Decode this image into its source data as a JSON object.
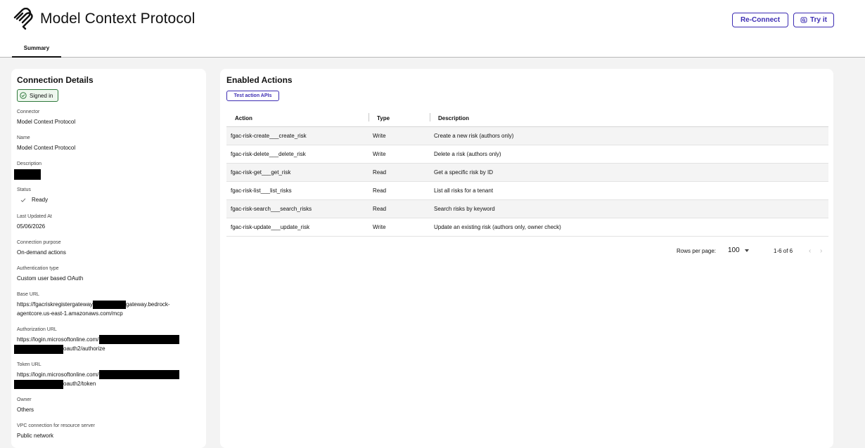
{
  "header": {
    "title": "Model Context Protocol",
    "reconnect_label": "Re-Connect",
    "tryit_label": "Try it",
    "logo_icon": "mcp-logo-icon"
  },
  "tabs": [
    {
      "label": "Summary",
      "active": true
    }
  ],
  "connection": {
    "title": "Connection Details",
    "badge": "Signed in",
    "connector_label": "Connector",
    "connector_value": "Model Context Protocol",
    "name_label": "Name",
    "name_value": "Model Context Protocol",
    "description_label": "Description",
    "status_label": "Status",
    "status_value": "Ready",
    "updated_label": "Last Updated At",
    "updated_value": "05/06/2026",
    "purpose_label": "Connection purpose",
    "purpose_value": "On-demand actions",
    "auth_label": "Authentication type",
    "auth_value": "Custom user based OAuth",
    "base_url_label": "Base URL",
    "base_url_part1": "https://fgacriskregistergateway",
    "base_url_part2": "gateway.bedrock-",
    "base_url_part3": "agentcore.us-east-1.amazonaws.com/mcp",
    "authz_url_label": "Authorization URL",
    "authz_url_part1": "https://login.microsoftonline.com/",
    "authz_url_part2": "oauth2/authorize",
    "token_url_label": "Token URL",
    "token_url_part1": "https://login.microsoftonline.com/",
    "token_url_part2": "oauth2/token",
    "owner_label": "Owner",
    "owner_value": "Others",
    "vpc_label": "VPC connection for resource server",
    "vpc_value": "Public network"
  },
  "actions": {
    "title": "Enabled Actions",
    "test_button": "Test action APIs",
    "columns": [
      "Action",
      "Type",
      "Description"
    ],
    "rows": [
      {
        "action": "fgac-risk-create___create_risk",
        "type": "Write",
        "description": "Create a new risk (authors only)"
      },
      {
        "action": "fgac-risk-delete___delete_risk",
        "type": "Write",
        "description": "Delete a risk (authors only)"
      },
      {
        "action": "fgac-risk-get___get_risk",
        "type": "Read",
        "description": "Get a specific risk by ID"
      },
      {
        "action": "fgac-risk-list___list_risks",
        "type": "Read",
        "description": "List all risks for a tenant"
      },
      {
        "action": "fgac-risk-search___search_risks",
        "type": "Read",
        "description": "Search risks by keyword"
      },
      {
        "action": "fgac-risk-update___update_risk",
        "type": "Write",
        "description": "Update an existing risk (authors only, owner check)"
      }
    ],
    "pagination": {
      "rows_label": "Rows per page:",
      "rows_value": "100",
      "range": "1-6 of 6"
    }
  },
  "colors": {
    "accent": "#3d2db3",
    "success": "#2f7a3c",
    "background": "#f3f3f3"
  }
}
